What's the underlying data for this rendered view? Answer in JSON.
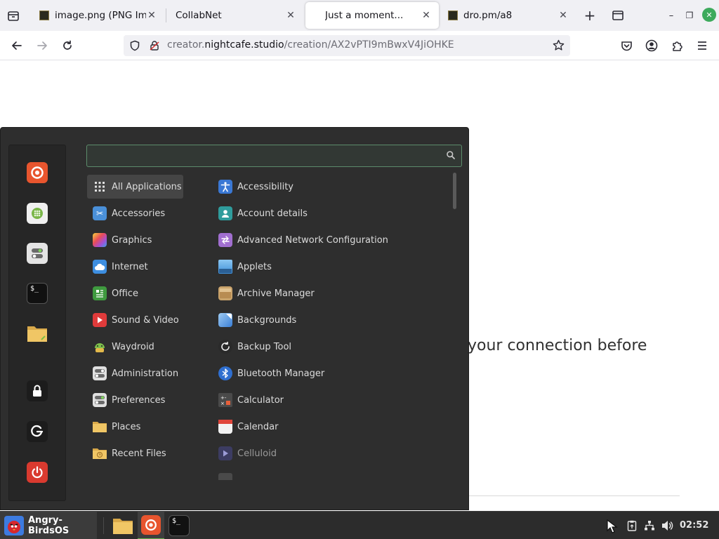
{
  "browser": {
    "tabs": [
      {
        "title": "image.png (PNG Image",
        "close": "✕",
        "has_favicon": true,
        "active": false
      },
      {
        "title": "CollabNet",
        "close": "✕",
        "has_favicon": false,
        "active": false
      },
      {
        "title": "Just a moment...",
        "close": "✕",
        "has_favicon": false,
        "active": true
      },
      {
        "title": "dro.pm/a8",
        "close": "✕",
        "has_favicon": true,
        "active": false
      }
    ],
    "new_tab": "+",
    "window_controls": {
      "minimize": "–",
      "restore": "❐",
      "close": "✕"
    },
    "url": {
      "prefix": "creator.",
      "domain": "nightcafe.studio",
      "path": "/creation/AX2vPTI9mBwxV4JiOHKE"
    }
  },
  "page": {
    "message": "your connection before"
  },
  "menu": {
    "search": {
      "value": "",
      "placeholder": ""
    },
    "favorites": [
      {
        "name": "firefox",
        "color": "#e8552e"
      },
      {
        "name": "software-manager",
        "color": "#8cc153"
      },
      {
        "name": "settings",
        "color": "#d0d0d0"
      },
      {
        "name": "terminal",
        "color": "#1a1a1a"
      },
      {
        "name": "files",
        "color": "#e8c46a"
      },
      {
        "name": "lock-screen",
        "color": "#1a1a1a"
      },
      {
        "name": "logout",
        "color": "#1a1a1a"
      },
      {
        "name": "shutdown",
        "color": "#d93a2f"
      }
    ],
    "categories": [
      {
        "label": "All Applications",
        "icon": "grid-icon",
        "color": "#d0d0d0"
      },
      {
        "label": "Accessories",
        "icon": "scissors-icon",
        "color": "#4a90d9"
      },
      {
        "label": "Graphics",
        "icon": "palette-icon",
        "color": "#c94fd0"
      },
      {
        "label": "Internet",
        "icon": "cloud-icon",
        "color": "#3d8ee0"
      },
      {
        "label": "Office",
        "icon": "document-icon",
        "color": "#3f9a3f"
      },
      {
        "label": "Sound & Video",
        "icon": "play-icon",
        "color": "#e03b3b"
      },
      {
        "label": "Waydroid",
        "icon": "android-icon",
        "color": "#7dbf4b"
      },
      {
        "label": "Administration",
        "icon": "toggles-icon",
        "color": "#c8c8c8"
      },
      {
        "label": "Preferences",
        "icon": "toggles-icon",
        "color": "#c8c8c8"
      },
      {
        "label": "Places",
        "icon": "folder-icon",
        "color": "#f0b846"
      },
      {
        "label": "Recent Files",
        "icon": "folder-clock-icon",
        "color": "#f0b846"
      }
    ],
    "apps": [
      {
        "label": "Accessibility",
        "icon": "accessibility-icon",
        "color": "#3a78d4"
      },
      {
        "label": "Account details",
        "icon": "account-icon",
        "color": "#2f9c9c"
      },
      {
        "label": "Advanced Network Configuration",
        "icon": "network-icon",
        "color": "#a16fd0"
      },
      {
        "label": "Applets",
        "icon": "applets-icon",
        "color": "#5aa5e6"
      },
      {
        "label": "Archive Manager",
        "icon": "archive-icon",
        "color": "#c9a36b"
      },
      {
        "label": "Backgrounds",
        "icon": "backgrounds-icon",
        "color": "#4a8ee0"
      },
      {
        "label": "Backup Tool",
        "icon": "backup-icon",
        "color": "#3a3a3a"
      },
      {
        "label": "Bluetooth Manager",
        "icon": "bluetooth-icon",
        "color": "#2f6fd0"
      },
      {
        "label": "Calculator",
        "icon": "calculator-icon",
        "color": "#555555"
      },
      {
        "label": "Calendar",
        "icon": "calendar-icon",
        "color": "#f2f2f2"
      },
      {
        "label": "Celluloid",
        "icon": "celluloid-icon",
        "color": "#4a4a7a"
      }
    ]
  },
  "taskbar": {
    "start_label": "Angry-BirdsOS",
    "clock": "02:52"
  }
}
